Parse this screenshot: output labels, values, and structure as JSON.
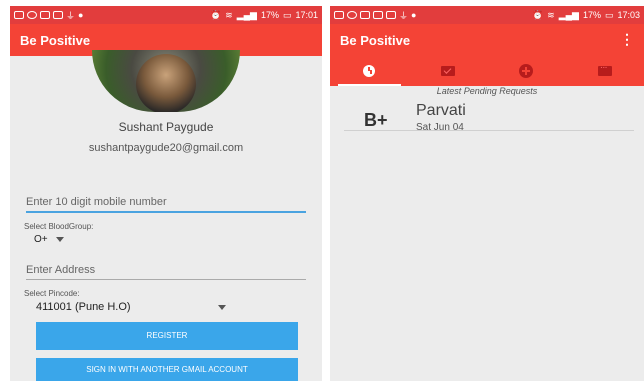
{
  "left_screen": {
    "status": {
      "battery": "17%",
      "time": "17:01"
    },
    "app_title": "Be Positive",
    "profile": {
      "name": "Sushant Paygude",
      "email": "sushantpaygude20@gmail.com"
    },
    "mobile_field": {
      "placeholder": "Enter 10 digit mobile number"
    },
    "bloodgroup": {
      "label": "Select BloodGroup:",
      "value": "O+"
    },
    "address_field": {
      "placeholder": "Enter Address"
    },
    "pincode": {
      "label": "Select Pincode:",
      "value": "411001 (Pune H.O)"
    },
    "buttons": {
      "register": "REGISTER",
      "signin_other": "SIGN IN WITH ANOTHER GMAIL ACCOUNT"
    }
  },
  "right_screen": {
    "status": {
      "battery": "17%",
      "time": "17:03"
    },
    "app_title": "Be Positive",
    "tabs": [
      {
        "icon": "clock-icon"
      },
      {
        "icon": "mail-icon"
      },
      {
        "icon": "plus-circle-icon"
      },
      {
        "icon": "chat-icon"
      }
    ],
    "section_title": "Latest Pending Requests",
    "requests": [
      {
        "blood_group": "B+",
        "name": "Parvati",
        "date": "Sat Jun 04"
      }
    ]
  }
}
